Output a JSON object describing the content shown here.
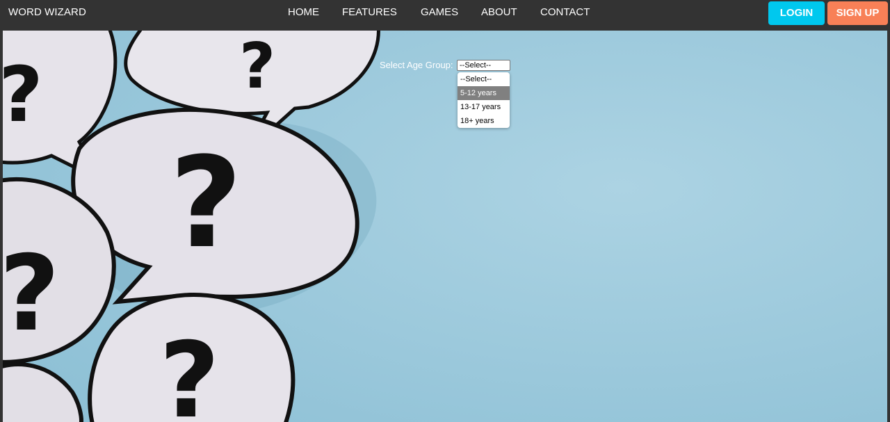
{
  "navbar": {
    "brand": "WORD WIZARD",
    "links": [
      "HOME",
      "FEATURES",
      "GAMES",
      "ABOUT",
      "CONTACT"
    ],
    "login_label": "LOGIN",
    "signup_label": "SIGN UP"
  },
  "age_select": {
    "label": "Select Age Group:",
    "value": "--Select--",
    "options": [
      "--Select--",
      "5-12 years",
      "13-17 years",
      "18+ years"
    ],
    "highlighted_option": "5-12 years"
  },
  "colors": {
    "navbar_bg": "#333333",
    "login_button": "#00c8ee",
    "signup_button": "#f88057",
    "hero_background": "#a6cfe0"
  },
  "icons": [
    "question-mark-speech-bubble-image",
    "chevron-down-icon"
  ]
}
